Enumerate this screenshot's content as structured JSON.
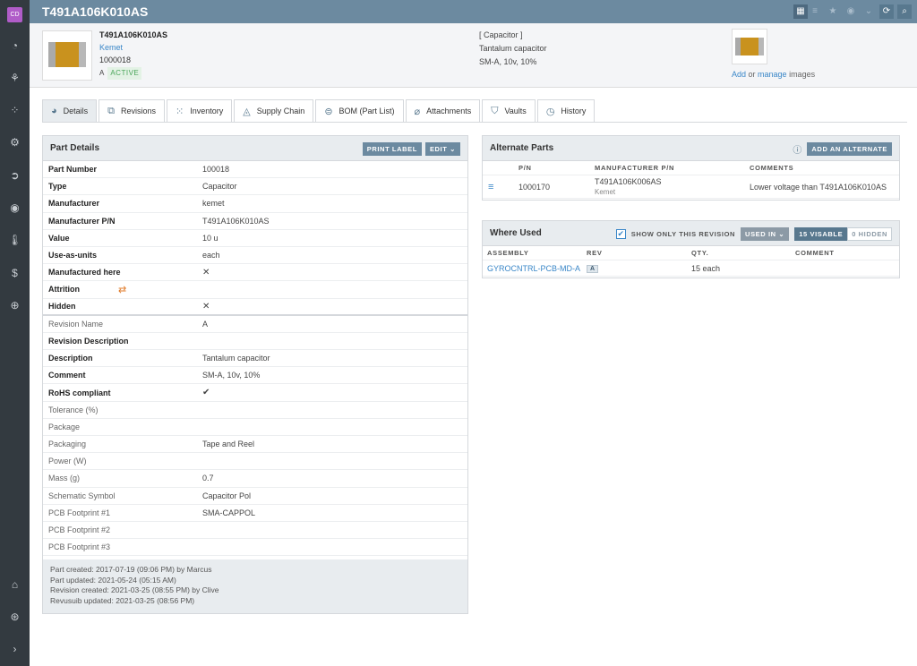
{
  "app": {
    "avatar": "CD",
    "title": "T491A106K010AS"
  },
  "sidebar": {
    "icons": [
      "dashboard-icon",
      "parts-icon",
      "grid-icon",
      "settings-icon",
      "arrow-icon",
      "location-icon",
      "thermometer-icon",
      "dollar-icon",
      "plus-circle-icon"
    ],
    "bottom_icons": [
      "home-icon",
      "network-icon",
      "expand-icon"
    ]
  },
  "part_header": {
    "part_name": "T491A106K010AS",
    "manufacturer": "Kemet",
    "part_number": "1000018",
    "revision": "A",
    "status": "ACTIVE",
    "category": "[ Capacitor ]",
    "description": "Tantalum capacitor",
    "comment": "SM-A, 10v, 10%",
    "images": {
      "add": "Add",
      "or": " or ",
      "manage": "manage",
      "suffix": " images"
    }
  },
  "tabs": [
    {
      "label": "Details",
      "icon": "details-icon"
    },
    {
      "label": "Revisions",
      "icon": "revisions-icon"
    },
    {
      "label": "Inventory",
      "icon": "inventory-icon"
    },
    {
      "label": "Supply Chain",
      "icon": "supply-chain-icon"
    },
    {
      "label": "BOM (Part List)",
      "icon": "bom-icon"
    },
    {
      "label": "Attachments",
      "icon": "attachment-icon"
    },
    {
      "label": "Vaults",
      "icon": "vault-icon"
    },
    {
      "label": "History",
      "icon": "history-icon"
    }
  ],
  "part_details": {
    "title": "Part Details",
    "print_label": "PRINT LABEL",
    "edit_label": "EDIT",
    "rows": [
      {
        "k": "Part Number",
        "v": "100018"
      },
      {
        "k": "Type",
        "v": "Capacitor"
      },
      {
        "k": "Manufacturer",
        "v": "kemet"
      },
      {
        "k": "Manufacturer P/N",
        "v": "T491A106K010AS"
      },
      {
        "k": "Value",
        "v": "10 u"
      },
      {
        "k": "Use-as-units",
        "v": "each"
      },
      {
        "k": "Manufactured here",
        "v": "✕"
      },
      {
        "k": "Attrition",
        "v": ""
      },
      {
        "k": "Hidden",
        "v": "✕"
      },
      {
        "k": "Revision Name",
        "v": "A"
      },
      {
        "k": "Revision Description",
        "v": ""
      },
      {
        "k": "Description",
        "v": "Tantalum capacitor"
      },
      {
        "k": "Comment",
        "v": "SM-A, 10v, 10%"
      },
      {
        "k": "RoHS compliant",
        "v": "✔"
      },
      {
        "k": "Tolerance (%)",
        "v": ""
      },
      {
        "k": "Package",
        "v": ""
      },
      {
        "k": "Packaging",
        "v": "Tape and Reel"
      },
      {
        "k": "Power (W)",
        "v": ""
      },
      {
        "k": "Mass (g)",
        "v": "0.7"
      },
      {
        "k": "Schematic Symbol",
        "v": "Capacitor Pol"
      },
      {
        "k": "PCB Footprint #1",
        "v": "SMA-CAPPOL"
      },
      {
        "k": "PCB Footprint #2",
        "v": ""
      },
      {
        "k": "PCB Footprint #3",
        "v": ""
      }
    ],
    "footer": [
      "Part created: 2017-07-19 (09:06 PM) by Marcus",
      "Part updated: 2021-05-24 (05:15 AM)",
      "Revision created: 2021-03-25 (08:55 PM) by Clive",
      "Revusuib updated: 2021-03-25 (08:56 PM)"
    ]
  },
  "alternate_parts": {
    "title": "Alternate Parts",
    "add_label": "ADD AN ALTERNATE",
    "columns": [
      "P/N",
      "MANUFACTURER P/N",
      "COMMENTS"
    ],
    "rows": [
      {
        "pn": "1000170",
        "mpn": "T491A106K006AS",
        "mfr": "Kemet",
        "comment": "Lower voltage than T491A106K010AS"
      }
    ]
  },
  "where_used": {
    "title": "Where Used",
    "show_only_label": "SHOW ONLY THIS REVISION",
    "used_in_label": "USED IN",
    "visible_label": "15 VISABLE",
    "hidden_label": "0 HIDDEN",
    "columns": [
      "ASSEMBLY",
      "REV",
      "QTY.",
      "COMMENT"
    ],
    "rows": [
      {
        "assembly": "GYROCNTRL-PCB-MD-A",
        "rev": "A",
        "qty": "15 each",
        "comment": ""
      }
    ]
  }
}
